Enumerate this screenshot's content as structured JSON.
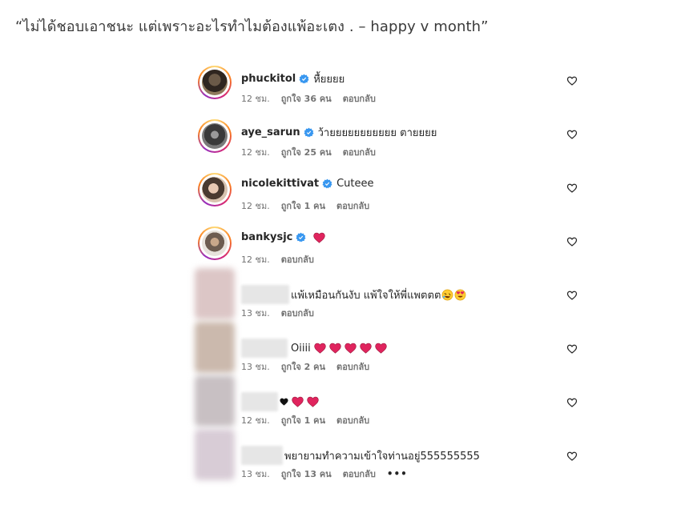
{
  "headline": "“ไม่ได้ชอบเอาชนะ แต่เพราะอะไรทำไมต้องแพ้อะเตง . – happy v month”",
  "comments": [
    {
      "username": "phuckitol",
      "text": "หื้ยยยย",
      "time": "12 ชม.",
      "likes": "ถูกใจ 36 คน",
      "reply": "ตอบกลับ"
    },
    {
      "username": "aye_sarun",
      "text": "ว้ายยยยยยยยยยย ตายยยย",
      "time": "12 ชม.",
      "likes": "ถูกใจ 25 คน",
      "reply": "ตอบกลับ"
    },
    {
      "username": "nicolekittivat",
      "text": "Cuteee",
      "time": "12 ชม.",
      "likes": "ถูกใจ 1 คน",
      "reply": "ตอบกลับ"
    },
    {
      "username": "bankysjc",
      "text": "",
      "time": "12 ชม.",
      "reply": "ตอบกลับ"
    },
    {
      "text": "แพ้เหมือนกันงับ แพ้ใจให้พี่แพตตต",
      "time": "13 ชม.",
      "reply": "ตอบกลับ"
    },
    {
      "text": "Oiiii",
      "time": "13 ชม.",
      "likes": "ถูกใจ 2 คน",
      "reply": "ตอบกลับ"
    },
    {
      "text": "",
      "time": "12 ชม.",
      "likes": "ถูกใจ 1 คน",
      "reply": "ตอบกลับ"
    },
    {
      "text": "พยายามทำความเข้าใจท่านอยู่555555555",
      "time": "13 ชม.",
      "likes": "ถูกใจ 13 คน",
      "reply": "ตอบกลับ",
      "more": "•••"
    }
  ],
  "colors": {
    "verified": "#3897f0",
    "emoji_heart": "#e0245e",
    "meta_text": "#737373"
  },
  "icons": [
    "verified-badge-icon",
    "heart-outline-icon",
    "red-heart-emoji",
    "rolling-laughing-emoji",
    "heart-eyes-emoji",
    "black-heart-emoji"
  ]
}
